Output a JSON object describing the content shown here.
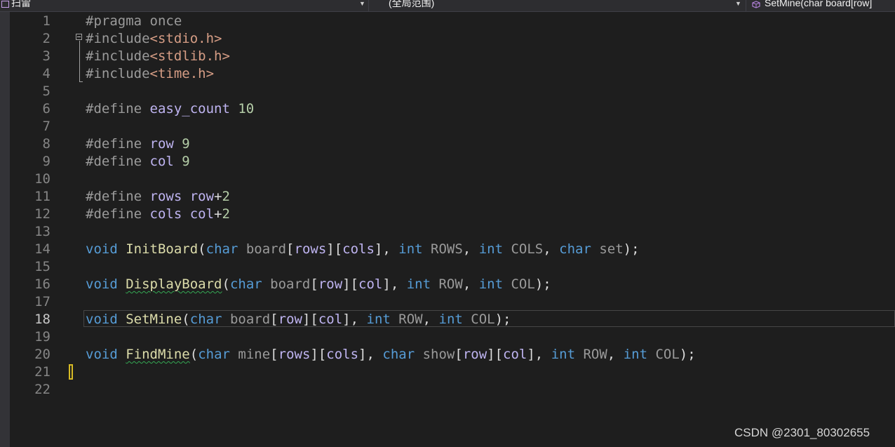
{
  "navbar": {
    "project": "扫雷",
    "scope": "(全局范围)",
    "member": "SetMine(char board[row]"
  },
  "editor": {
    "current_line": 18,
    "line_numbers": [
      "1",
      "2",
      "3",
      "4",
      "5",
      "6",
      "7",
      "8",
      "9",
      "10",
      "11",
      "12",
      "13",
      "14",
      "15",
      "16",
      "17",
      "18",
      "19",
      "20",
      "21",
      "22"
    ],
    "lines": [
      [
        {
          "t": "#pragma once",
          "c": "pp"
        }
      ],
      [
        {
          "t": "#include",
          "c": "pp"
        },
        {
          "t": "<stdio.h>",
          "c": "str"
        }
      ],
      [
        {
          "t": "#include",
          "c": "pp"
        },
        {
          "t": "<stdlib.h>",
          "c": "str"
        }
      ],
      [
        {
          "t": "#include",
          "c": "pp"
        },
        {
          "t": "<time.h>",
          "c": "str"
        }
      ],
      [],
      [
        {
          "t": "#define ",
          "c": "pp"
        },
        {
          "t": "easy_count",
          "c": "macro"
        },
        {
          "t": " ",
          "c": ""
        },
        {
          "t": "10",
          "c": "num"
        }
      ],
      [],
      [
        {
          "t": "#define ",
          "c": "pp"
        },
        {
          "t": "row",
          "c": "macro"
        },
        {
          "t": " ",
          "c": ""
        },
        {
          "t": "9",
          "c": "num"
        }
      ],
      [
        {
          "t": "#define ",
          "c": "pp"
        },
        {
          "t": "col",
          "c": "macro"
        },
        {
          "t": " ",
          "c": ""
        },
        {
          "t": "9",
          "c": "num"
        }
      ],
      [],
      [
        {
          "t": "#define ",
          "c": "pp"
        },
        {
          "t": "rows",
          "c": "macro"
        },
        {
          "t": " ",
          "c": ""
        },
        {
          "t": "row",
          "c": "macro"
        },
        {
          "t": "+",
          "c": ""
        },
        {
          "t": "2",
          "c": "num"
        }
      ],
      [
        {
          "t": "#define ",
          "c": "pp"
        },
        {
          "t": "cols",
          "c": "macro"
        },
        {
          "t": " ",
          "c": ""
        },
        {
          "t": "col",
          "c": "macro"
        },
        {
          "t": "+",
          "c": ""
        },
        {
          "t": "2",
          "c": "num"
        }
      ],
      [],
      [
        {
          "t": "void",
          "c": "kw"
        },
        {
          "t": " ",
          "c": ""
        },
        {
          "t": "InitBoard",
          "c": "fn"
        },
        {
          "t": "(",
          "c": ""
        },
        {
          "t": "char",
          "c": "kw"
        },
        {
          "t": " ",
          "c": ""
        },
        {
          "t": "board",
          "c": "param"
        },
        {
          "t": "[",
          "c": ""
        },
        {
          "t": "rows",
          "c": "macro"
        },
        {
          "t": "][",
          "c": ""
        },
        {
          "t": "cols",
          "c": "macro"
        },
        {
          "t": "], ",
          "c": ""
        },
        {
          "t": "int",
          "c": "kw"
        },
        {
          "t": " ",
          "c": ""
        },
        {
          "t": "ROWS",
          "c": "param"
        },
        {
          "t": ", ",
          "c": ""
        },
        {
          "t": "int",
          "c": "kw"
        },
        {
          "t": " ",
          "c": ""
        },
        {
          "t": "COLS",
          "c": "param"
        },
        {
          "t": ", ",
          "c": ""
        },
        {
          "t": "char",
          "c": "kw"
        },
        {
          "t": " ",
          "c": ""
        },
        {
          "t": "set",
          "c": "param"
        },
        {
          "t": ");",
          "c": ""
        }
      ],
      [],
      [
        {
          "t": "void",
          "c": "kw"
        },
        {
          "t": " ",
          "c": ""
        },
        {
          "t": "DisplayBoard",
          "c": "fn squig"
        },
        {
          "t": "(",
          "c": ""
        },
        {
          "t": "char",
          "c": "kw"
        },
        {
          "t": " ",
          "c": ""
        },
        {
          "t": "board",
          "c": "param"
        },
        {
          "t": "[",
          "c": ""
        },
        {
          "t": "row",
          "c": "macro"
        },
        {
          "t": "][",
          "c": ""
        },
        {
          "t": "col",
          "c": "macro"
        },
        {
          "t": "], ",
          "c": ""
        },
        {
          "t": "int",
          "c": "kw"
        },
        {
          "t": " ",
          "c": ""
        },
        {
          "t": "ROW",
          "c": "param"
        },
        {
          "t": ", ",
          "c": ""
        },
        {
          "t": "int",
          "c": "kw"
        },
        {
          "t": " ",
          "c": ""
        },
        {
          "t": "COL",
          "c": "param"
        },
        {
          "t": ");",
          "c": ""
        }
      ],
      [],
      [
        {
          "t": "void",
          "c": "kw"
        },
        {
          "t": " ",
          "c": ""
        },
        {
          "t": "SetMine",
          "c": "fn"
        },
        {
          "t": "(",
          "c": ""
        },
        {
          "t": "char",
          "c": "kw"
        },
        {
          "t": " ",
          "c": ""
        },
        {
          "t": "board",
          "c": "param"
        },
        {
          "t": "[",
          "c": ""
        },
        {
          "t": "row",
          "c": "macro"
        },
        {
          "t": "][",
          "c": ""
        },
        {
          "t": "col",
          "c": "macro"
        },
        {
          "t": "], ",
          "c": ""
        },
        {
          "t": "int",
          "c": "kw"
        },
        {
          "t": " ",
          "c": ""
        },
        {
          "t": "ROW",
          "c": "param"
        },
        {
          "t": ", ",
          "c": ""
        },
        {
          "t": "int",
          "c": "kw"
        },
        {
          "t": " ",
          "c": ""
        },
        {
          "t": "COL",
          "c": "param"
        },
        {
          "t": ");",
          "c": ""
        }
      ],
      [],
      [
        {
          "t": "void",
          "c": "kw"
        },
        {
          "t": " ",
          "c": ""
        },
        {
          "t": "FindMine",
          "c": "fn squig"
        },
        {
          "t": "(",
          "c": ""
        },
        {
          "t": "char",
          "c": "kw"
        },
        {
          "t": " ",
          "c": ""
        },
        {
          "t": "mine",
          "c": "param"
        },
        {
          "t": "[",
          "c": ""
        },
        {
          "t": "rows",
          "c": "macro"
        },
        {
          "t": "][",
          "c": ""
        },
        {
          "t": "cols",
          "c": "macro"
        },
        {
          "t": "], ",
          "c": ""
        },
        {
          "t": "char",
          "c": "kw"
        },
        {
          "t": " ",
          "c": ""
        },
        {
          "t": "show",
          "c": "param"
        },
        {
          "t": "[",
          "c": ""
        },
        {
          "t": "row",
          "c": "macro"
        },
        {
          "t": "][",
          "c": ""
        },
        {
          "t": "col",
          "c": "macro"
        },
        {
          "t": "], ",
          "c": ""
        },
        {
          "t": "int",
          "c": "kw"
        },
        {
          "t": " ",
          "c": ""
        },
        {
          "t": "ROW",
          "c": "param"
        },
        {
          "t": ", ",
          "c": ""
        },
        {
          "t": "int",
          "c": "kw"
        },
        {
          "t": " ",
          "c": ""
        },
        {
          "t": "COL",
          "c": "param"
        },
        {
          "t": ");",
          "c": ""
        }
      ],
      [],
      []
    ]
  },
  "watermark": "CSDN @2301_80302655"
}
